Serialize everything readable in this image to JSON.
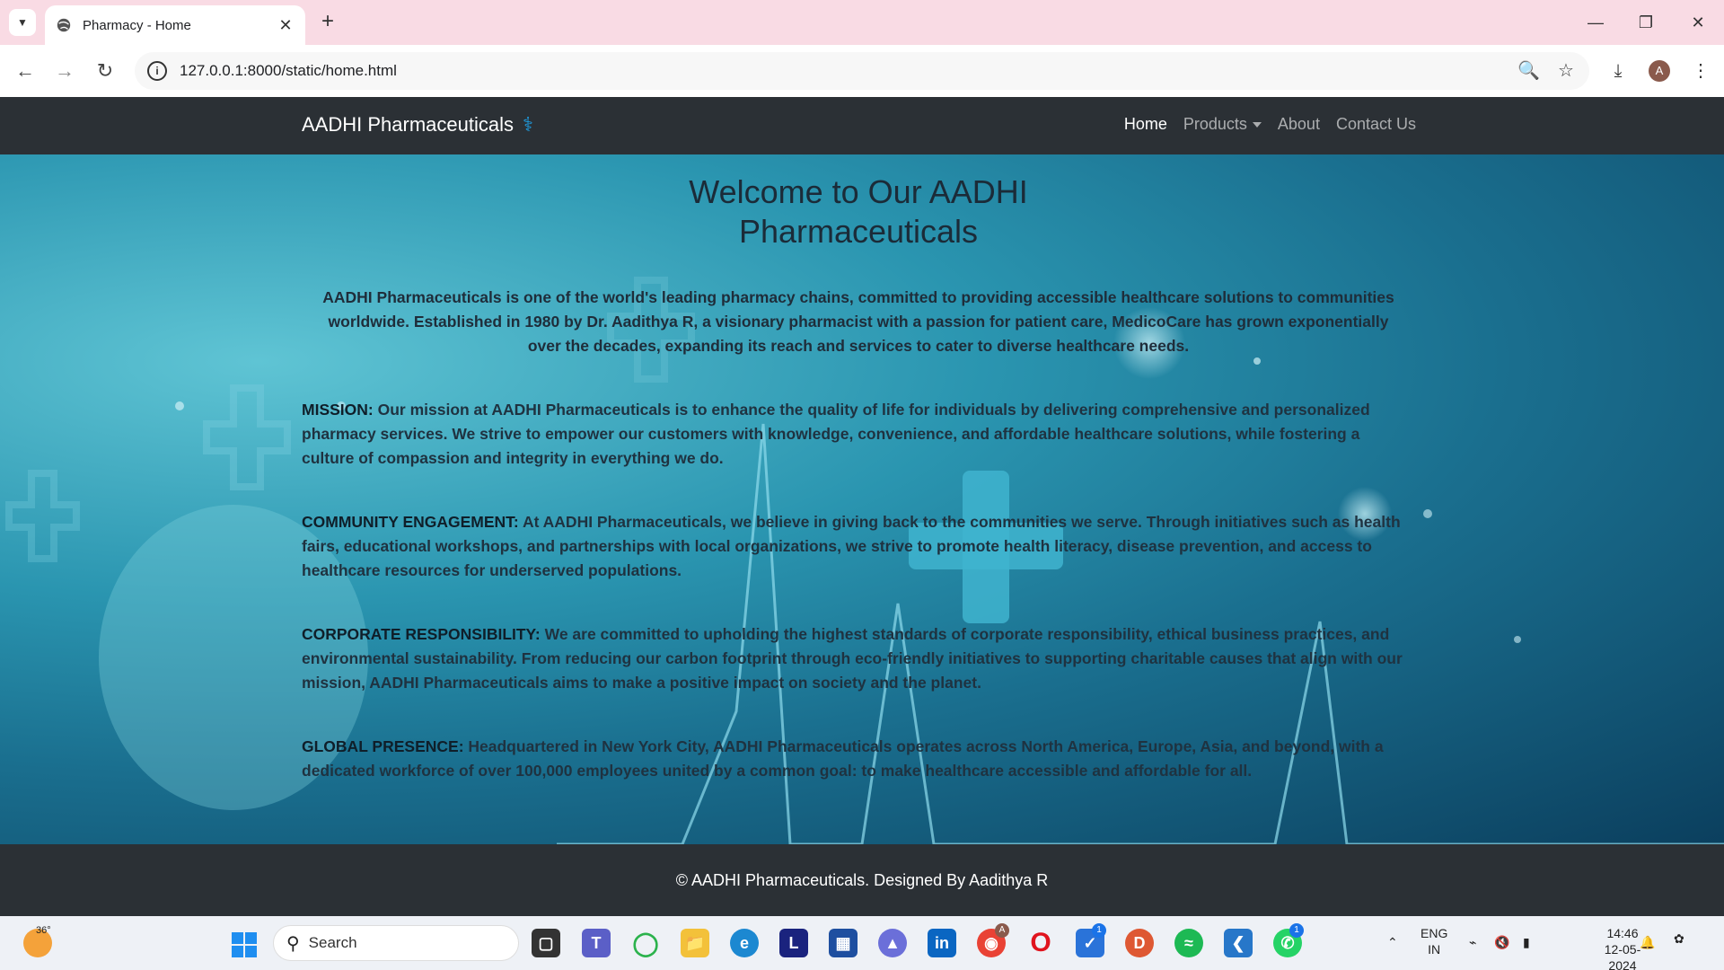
{
  "browser": {
    "tab_title": "Pharmacy - Home",
    "url": "127.0.0.1:8000/static/home.html",
    "avatar_letter": "A"
  },
  "site": {
    "brand": "AADHI Pharmaceuticals",
    "nav": {
      "home": "Home",
      "products": "Products",
      "about": "About",
      "contact": "Contact Us"
    },
    "welcome_line1": "Welcome to Our AADHI",
    "welcome_line2": "Pharmaceuticals",
    "intro": "AADHI Pharmaceuticals is one of the world's leading pharmacy chains, committed to providing accessible healthcare solutions to communities worldwide. Established in 1980 by Dr. Aadithya R, a visionary pharmacist with a passion for patient care, MedicoCare has grown exponentially over the decades, expanding its reach and services to cater to diverse healthcare needs.",
    "sections": [
      {
        "heading": "MISSION:",
        "text": " Our mission at AADHI Pharmaceuticals is to enhance the quality of life for individuals by delivering comprehensive and personalized pharmacy services. We strive to empower our customers with knowledge, convenience, and affordable healthcare solutions, while fostering a culture of compassion and integrity in everything we do."
      },
      {
        "heading": "COMMUNITY ENGAGEMENT:",
        "text": " At AADHI Pharmaceuticals, we believe in giving back to the communities we serve. Through initiatives such as health fairs, educational workshops, and partnerships with local organizations, we strive to promote health literacy, disease prevention, and access to healthcare resources for underserved populations."
      },
      {
        "heading": "CORPORATE RESPONSIBILITY:",
        "text": " We are committed to upholding the highest standards of corporate responsibility, ethical business practices, and environmental sustainability. From reducing our carbon footprint through eco-friendly initiatives to supporting charitable causes that align with our mission, AADHI Pharmaceuticals aims to make a positive impact on society and the planet."
      },
      {
        "heading": "GLOBAL PRESENCE:",
        "text": " Headquartered in New York City, AADHI Pharmaceuticals operates across North America, Europe, Asia, and beyond, with a dedicated workforce of over 100,000 employees united by a common goal: to make healthcare accessible and affordable for all."
      }
    ],
    "footer": "© AADHI Pharmaceuticals. Designed By Aadithya R"
  },
  "taskbar": {
    "weather_temp": "36°",
    "search_label": "Search",
    "lang_line1": "ENG",
    "lang_line2": "IN",
    "time": "14:46",
    "date": "12-05-2024",
    "badge_count": "1",
    "chrome_badge": "A"
  },
  "colors": {
    "nav_bg": "#2b3035",
    "accent": "#1ea0e6"
  }
}
